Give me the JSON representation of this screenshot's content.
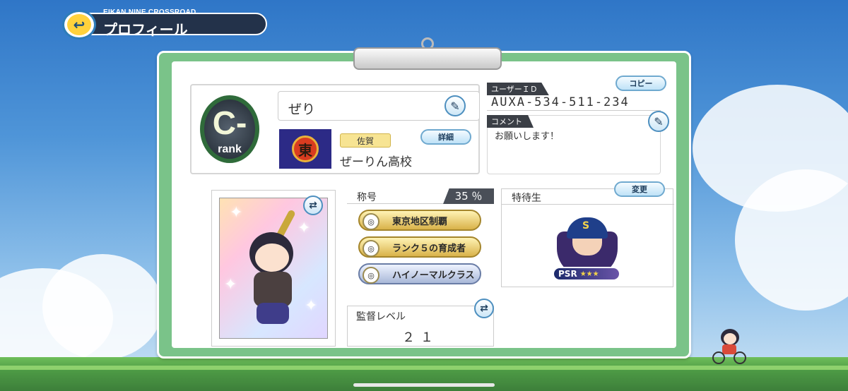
{
  "header": {
    "subtitle": "EIKAN NINE CROSSROAD",
    "title": "プロフィール",
    "back_icon": "back-arrow-icon"
  },
  "profile": {
    "rank_letter": "C-",
    "rank_word": "rank",
    "name": "ぜり",
    "school_crest_char": "東",
    "prefecture": "佐賀",
    "school_name": "ぜーりん高校",
    "detail_button": "詳細"
  },
  "user": {
    "id_label": "ユーザーＩＤ",
    "id_value": "AUXA-534-511-234",
    "copy_button": "コピー",
    "comment_label": "コメント",
    "comment_text": "お願いします！"
  },
  "titles": {
    "label": "称号",
    "percent": "35 ％",
    "items": [
      {
        "text": "東京地区制覇",
        "style": "gold"
      },
      {
        "text": "ランク５の育成者",
        "style": "gold"
      },
      {
        "text": "ハイノーマルクラス",
        "style": "silver"
      }
    ]
  },
  "manager": {
    "label": "監督レベル",
    "level": "２１"
  },
  "tokutai": {
    "label": "特待生",
    "change_button": "変更",
    "badge": "PSR",
    "stars": "★★★"
  }
}
